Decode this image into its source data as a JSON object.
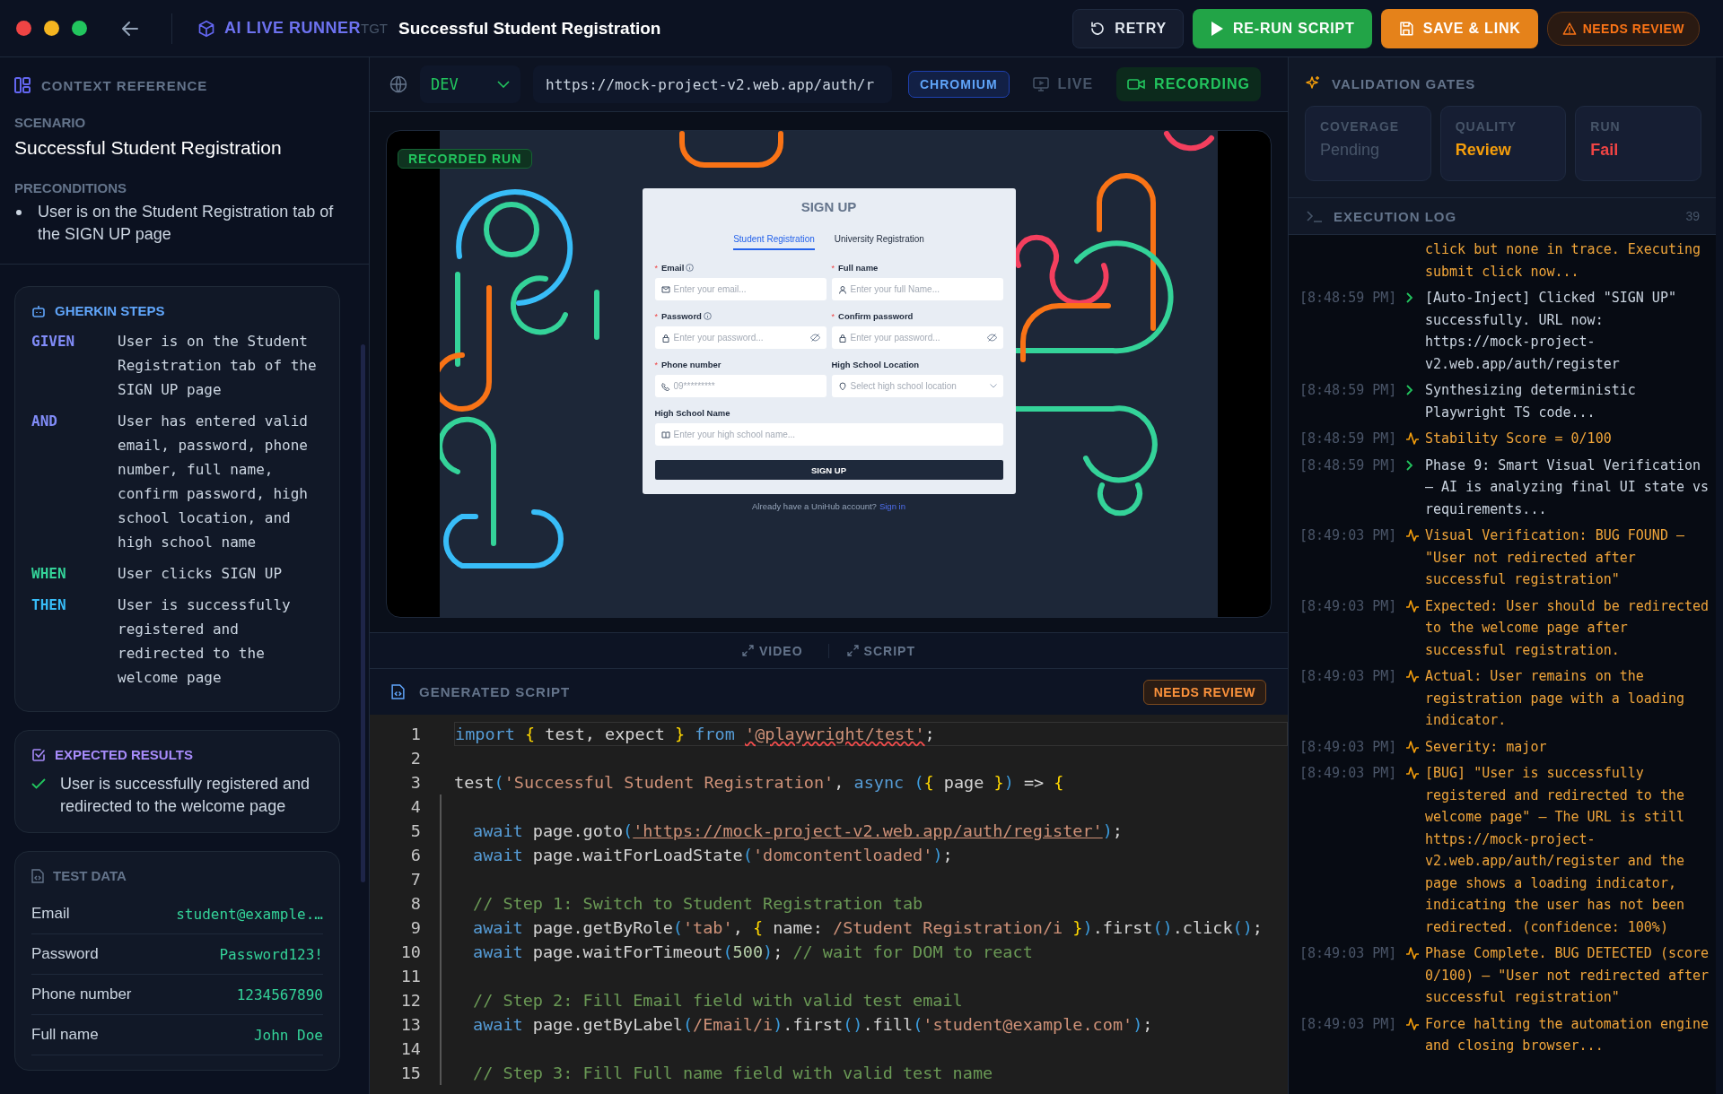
{
  "header": {
    "app_name": "AI LIVE RUNNER",
    "tag": "TGT",
    "title": "Successful Student Registration",
    "buttons": [
      {
        "label": "RETRY",
        "kind": "retry"
      },
      {
        "label": "RE-RUN SCRIPT",
        "kind": "run"
      },
      {
        "label": "SAVE & LINK",
        "kind": "save"
      }
    ],
    "status_badge": "NEEDS REVIEW"
  },
  "context": {
    "heading": "CONTEXT REFERENCE",
    "scenario_label": "SCENARIO",
    "scenario": "Successful Student Registration",
    "preconditions_label": "PRECONDITIONS",
    "preconditions": [
      "User is on the Student Registration tab of the SIGN UP page"
    ]
  },
  "gherkin": {
    "heading": "GHERKIN STEPS",
    "steps": [
      {
        "keyword": "GIVEN",
        "kind": "given",
        "text": "User is on the Student Registration tab of the SIGN UP page"
      },
      {
        "keyword": "AND",
        "kind": "and",
        "text": "User has entered valid email, password, phone number, full name, confirm password, high school location, and high school name"
      },
      {
        "keyword": "WHEN",
        "kind": "when",
        "text": "User clicks SIGN UP"
      },
      {
        "keyword": "THEN",
        "kind": "then",
        "text": "User is successfully registered and redirected to the welcome page"
      }
    ]
  },
  "expected": {
    "heading": "EXPECTED RESULTS",
    "items": [
      "User is successfully registered and redirected to the welcome page"
    ]
  },
  "test_data": {
    "heading": "TEST DATA",
    "rows": [
      {
        "label": "Email",
        "value": "student@example.…"
      },
      {
        "label": "Password",
        "value": "Password123!"
      },
      {
        "label": "Phone number",
        "value": "1234567890"
      },
      {
        "label": "Full name",
        "value": "John Doe"
      }
    ]
  },
  "browser_bar": {
    "environment": "DEV",
    "url": "https://mock-project-v2.web.app/auth/r",
    "browser": "CHROMIUM",
    "modes": [
      {
        "label": "LIVE",
        "kind": "live",
        "selected": false
      },
      {
        "label": "RECORDING",
        "kind": "recording",
        "selected": true
      }
    ]
  },
  "recording": {
    "badge": "RECORDED RUN",
    "page": {
      "title": "SIGN UP",
      "tabs": [
        {
          "label": "Student Registration",
          "selected": true
        },
        {
          "label": "University Registration",
          "selected": false
        }
      ],
      "fields": [
        {
          "required_mark": "*",
          "label": "Email",
          "info": true,
          "placeholder": "Enter your email...",
          "kind": "email"
        },
        {
          "required_mark": "*",
          "label": "Full name",
          "info": false,
          "placeholder": "Enter your full Name...",
          "kind": "name"
        },
        {
          "required_mark": "*",
          "label": "Password",
          "info": true,
          "placeholder": "Enter your password...",
          "kind": "password"
        },
        {
          "required_mark": "*",
          "label": "Confirm password",
          "info": false,
          "placeholder": "Enter your password...",
          "kind": "password"
        },
        {
          "required_mark": "*",
          "label": "Phone number",
          "info": false,
          "placeholder": "09*********",
          "kind": "phone"
        },
        {
          "label": "High School Location",
          "info": false,
          "placeholder": "Select high school location",
          "kind": "select"
        },
        {
          "label": "High School Name",
          "info": false,
          "placeholder": "Enter your high school name...",
          "kind": "wide"
        }
      ],
      "submit": "SIGN UP",
      "footer": "Already have a UniHub account?",
      "footer_link": "Sign in"
    }
  },
  "view_toggles": [
    "VIDEO",
    "SCRIPT"
  ],
  "script": {
    "heading": "GENERATED SCRIPT",
    "badge": "NEEDS REVIEW",
    "lines": [
      {
        "num": "1",
        "indent": false,
        "current": true,
        "lint_error": true,
        "text": "import { test, expect } from '@playwright/test';"
      },
      {
        "num": "2",
        "indent": false,
        "current": false
      },
      {
        "num": "3",
        "indent": false,
        "current": false,
        "lint_error": false,
        "text": "test('Successful Student Registration', async ({ page }) => {"
      },
      {
        "num": "4",
        "indent": true,
        "current": false
      },
      {
        "num": "5",
        "indent": true,
        "current": false,
        "lint_error": false,
        "text": "await page.goto('https://mock-project-v2.web.app/auth/register');"
      },
      {
        "num": "6",
        "indent": true,
        "current": false,
        "lint_error": false,
        "text": "await page.waitForLoadState('domcontentloaded');"
      },
      {
        "num": "7",
        "indent": true,
        "current": false
      },
      {
        "num": "8",
        "indent": true,
        "current": false,
        "lint_error": false,
        "text": "// Step 1: Switch to Student Registration tab"
      },
      {
        "num": "9",
        "indent": true,
        "current": false,
        "lint_error": false,
        "text": "await page.getByRole('tab', { name: /Student Registration/i }).first().click();"
      },
      {
        "num": "10",
        "indent": true,
        "current": false,
        "lint_error": false,
        "text": "await page.waitForTimeout(500); // wait for DOM to react"
      },
      {
        "num": "11",
        "indent": true,
        "current": false
      },
      {
        "num": "12",
        "indent": true,
        "current": false,
        "lint_error": false,
        "text": "// Step 2: Fill Email field with valid test email"
      },
      {
        "num": "13",
        "indent": true,
        "current": false,
        "lint_error": false,
        "text": "await page.getByLabel(/Email/i).first().fill('student@example.com');"
      },
      {
        "num": "14",
        "indent": true,
        "current": false
      },
      {
        "num": "15",
        "indent": true,
        "current": false,
        "lint_error": false,
        "text": "// Step 3: Fill Full name field with valid test name"
      }
    ]
  },
  "validation": {
    "heading": "VALIDATION GATES",
    "gates": [
      {
        "label": "COVERAGE",
        "value": "Pending",
        "kind": "pending"
      },
      {
        "label": "QUALITY",
        "value": "Review",
        "kind": "review"
      },
      {
        "label": "RUN",
        "value": "Fail",
        "kind": "fail"
      }
    ]
  },
  "log": {
    "heading": "EXECUTION LOG",
    "count": "39",
    "entries": [
      {
        "kind": "cont",
        "text": "click but none in trace. Executing submit click now..."
      },
      {
        "time": "[8:48:59 PM]",
        "kind": "info",
        "text": "[Auto-Inject] Clicked \"SIGN UP\" successfully. URL now: https://mock-project-v2.web.app/auth/register"
      },
      {
        "time": "[8:48:59 PM]",
        "kind": "info",
        "text": "Synthesizing deterministic Playwright TS code..."
      },
      {
        "time": "[8:48:59 PM]",
        "kind": "warn",
        "text": "Stability Score = 0/100"
      },
      {
        "time": "[8:48:59 PM]",
        "kind": "info",
        "text": "Phase 9: Smart Visual Verification — AI is analyzing final UI state vs requirements..."
      },
      {
        "time": "[8:49:03 PM]",
        "kind": "warn",
        "text": "Visual Verification: BUG FOUND — \"User not redirected after successful registration\""
      },
      {
        "time": "[8:49:03 PM]",
        "kind": "warn",
        "text": "Expected: User should be redirected to the welcome page after successful registration."
      },
      {
        "time": "[8:49:03 PM]",
        "kind": "warn",
        "text": "Actual: User remains on the registration page with a loading indicator."
      },
      {
        "time": "[8:49:03 PM]",
        "kind": "warn",
        "text": "Severity: major"
      },
      {
        "time": "[8:49:03 PM]",
        "kind": "warn",
        "text": "[BUG] \"User is successfully registered and redirected to the welcome page\" — The URL is still https://mock-project-v2.web.app/auth/register and the page shows a loading indicator, indicating the user has not been redirected. (confidence: 100%)"
      },
      {
        "time": "[8:49:03 PM]",
        "kind": "warn",
        "text": "Phase Complete. BUG DETECTED (score 0/100) — \"User not redirected after successful registration\""
      },
      {
        "time": "[8:49:03 PM]",
        "kind": "warn",
        "text": "Force halting the automation engine and closing browser..."
      }
    ]
  }
}
